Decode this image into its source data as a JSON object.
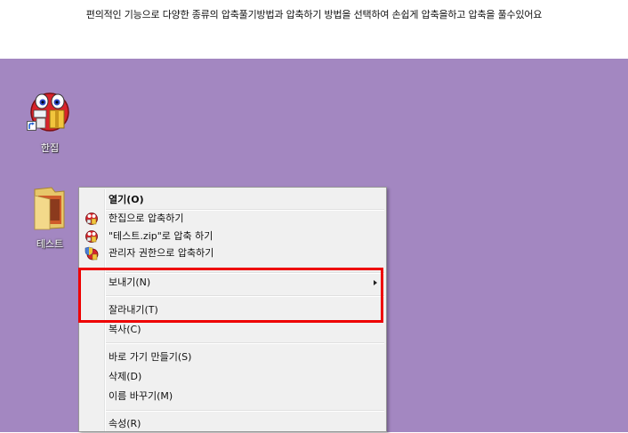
{
  "caption": {
    "text": "편의적인 기능으로 다양한 종류의 압축풀기방법과 압축하기 방법을 선택하여 손쉽게 압축을하고 압축을 풀수있어요"
  },
  "desktop": {
    "background": "#a387c1",
    "icons": [
      {
        "label": "한집",
        "icon": "hanzip-app-icon"
      },
      {
        "label": "테스트",
        "icon": "folder-icon"
      }
    ]
  },
  "context_menu": {
    "open": "열기(O)",
    "compress_hanzip": "한집으로 압축하기",
    "compress_zip": "\"테스트.zip\"로 압축 하기",
    "compress_admin": "관리자 권한으로 압축하기",
    "send_to": "보내기(N)",
    "cut": "잘라내기(T)",
    "copy": "복사(C)",
    "create_shortcut": "바로 가기 만들기(S)",
    "delete": "삭제(D)",
    "rename": "이름 바꾸기(M)",
    "properties": "속성(R)"
  },
  "highlight_color": "#ee0000"
}
